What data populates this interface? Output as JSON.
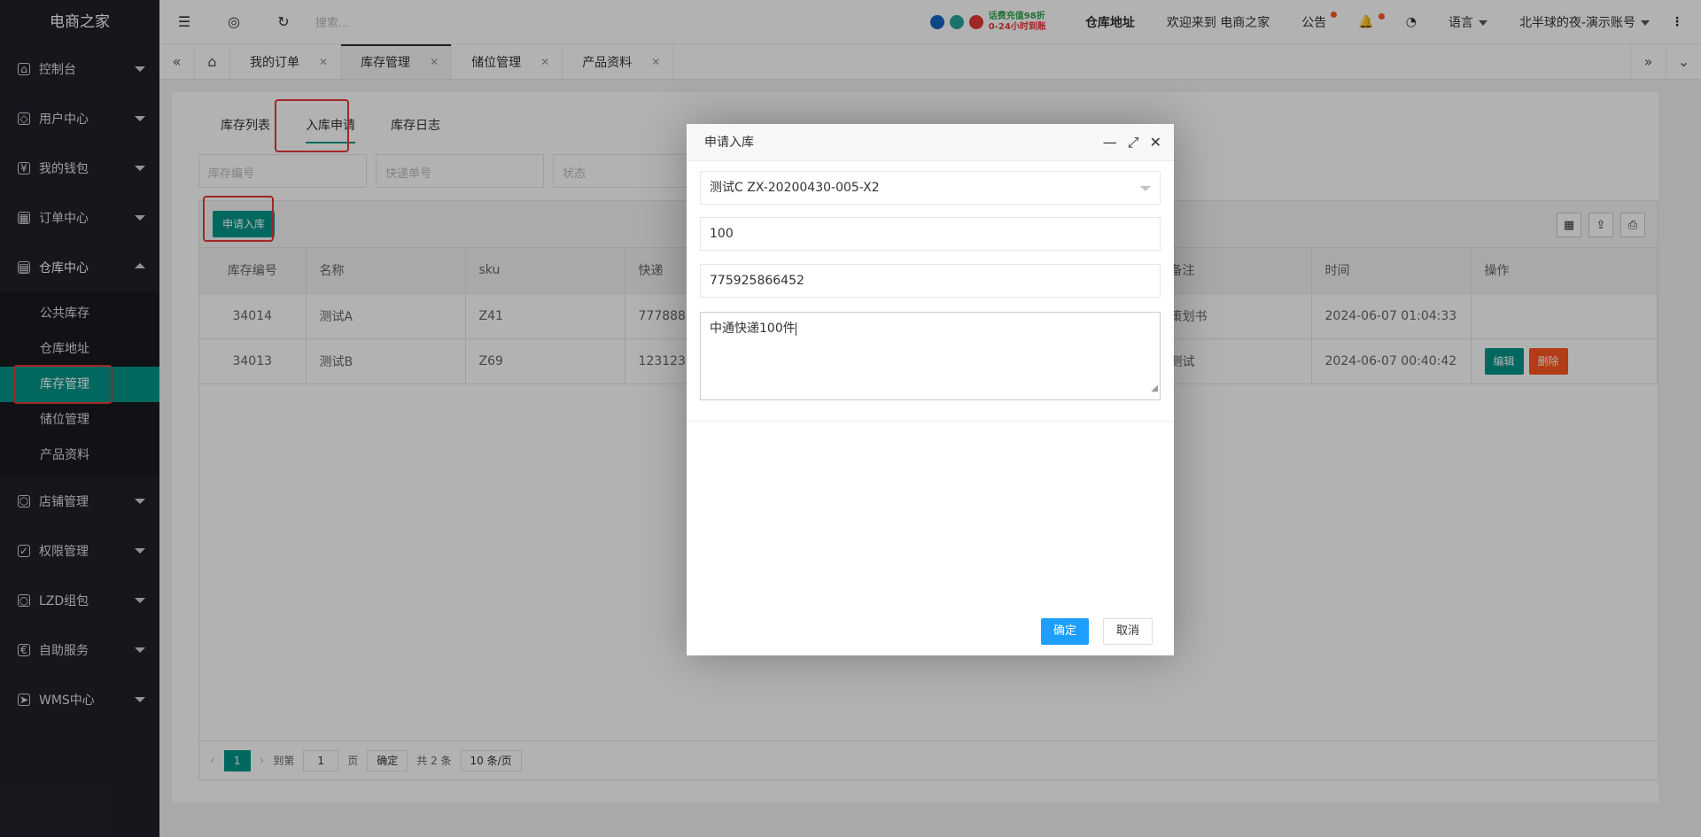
{
  "sidebar": {
    "title": "电商之家",
    "items": [
      {
        "label": "控制台",
        "icon": "home-icon"
      },
      {
        "label": "用户中心",
        "icon": "diamond-icon"
      },
      {
        "label": "我的钱包",
        "icon": "wallet-icon"
      },
      {
        "label": "订单中心",
        "icon": "order-icon"
      },
      {
        "label": "仓库中心",
        "icon": "warehouse-icon"
      },
      {
        "label": "店铺管理",
        "icon": "shop-icon"
      },
      {
        "label": "权限管理",
        "icon": "shield-icon"
      },
      {
        "label": "LZD组包",
        "icon": "package-icon"
      },
      {
        "label": "自助服务",
        "icon": "service-icon"
      },
      {
        "label": "WMS中心",
        "icon": "send-icon"
      }
    ],
    "warehouse_sub": [
      "公共库存",
      "仓库地址",
      "库存管理",
      "储位管理",
      "产品资料"
    ]
  },
  "header": {
    "search_placeholder": "搜索...",
    "promo_line1": "话费充值98折",
    "promo_line2": "0-24小时到账",
    "warehouse_address": "仓库地址",
    "welcome": "欢迎来到 电商之家",
    "notice": "公告",
    "language": "语言",
    "account": "北半球的夜-演示账号"
  },
  "tabs": [
    "我的订单",
    "库存管理",
    "储位管理",
    "产品资料"
  ],
  "subtabs": [
    "库存列表",
    "入库申请",
    "库存日志"
  ],
  "filters": {
    "stock_no": "库存编号",
    "express_no": "快递单号",
    "status": "状态"
  },
  "toolbar": {
    "apply_label": "申请入库"
  },
  "table": {
    "headers": [
      "库存编号",
      "名称",
      "sku",
      "快递",
      "备注",
      "时间",
      "操作"
    ],
    "rows": [
      {
        "id": "34014",
        "name": "测试A",
        "sku": "Z41",
        "express": "7778889",
        "remark": "策划书",
        "time": "2024-06-07 01:04:33"
      },
      {
        "id": "34013",
        "name": "测试B",
        "sku": "Z69",
        "express": "123123",
        "remark": "测试",
        "time": "2024-06-07 00:40:42"
      }
    ],
    "edit_label": "编辑",
    "delete_label": "删除"
  },
  "pager": {
    "page": "1",
    "goto_label": "到第",
    "goto_value": "1",
    "page_unit": "页",
    "confirm": "确定",
    "total": "共 2 条",
    "per_page": "10 条/页"
  },
  "modal": {
    "title": "申请入库",
    "product": "测试C ZX-20200430-005-X2",
    "quantity": "100",
    "tracking": "775925866452",
    "note": "中通快递100件",
    "ok": "确定",
    "cancel": "取消"
  }
}
